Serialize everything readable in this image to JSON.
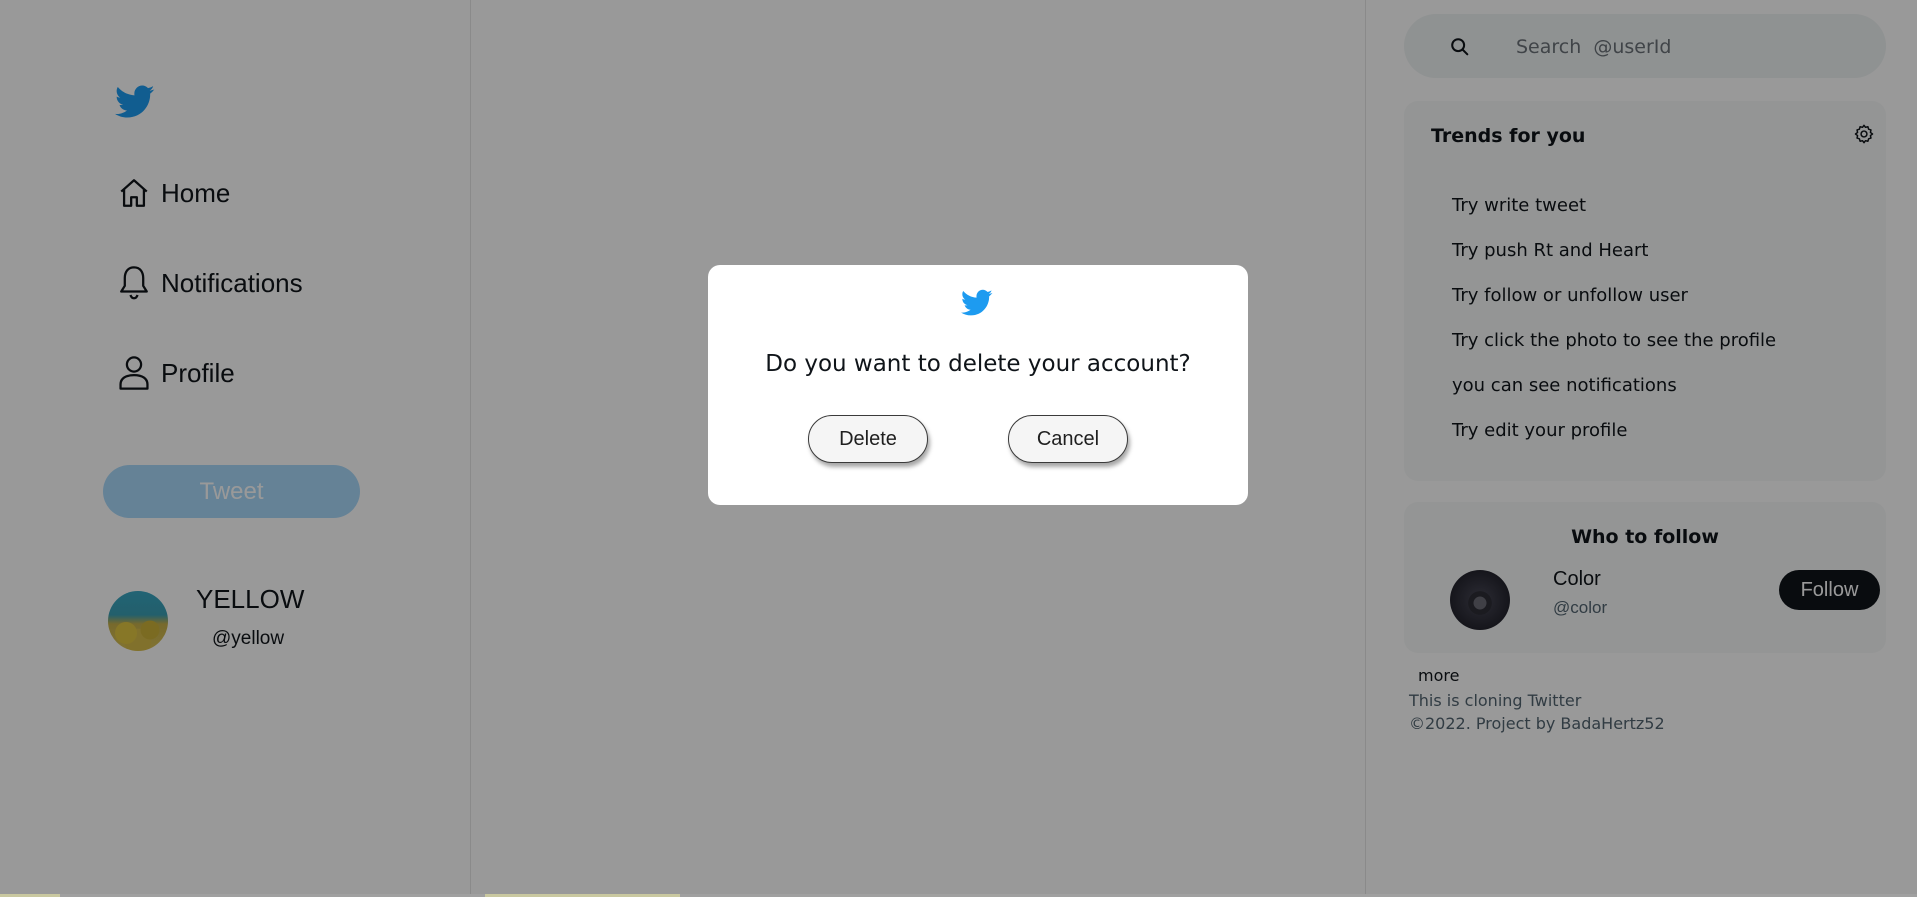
{
  "colors": {
    "brand": "#1d9bf0",
    "tweet_button_disabled": "#a9d9fb",
    "overlay": "rgba(0,0,0,0.40)",
    "follow_button": "#0f1419"
  },
  "sidebar": {
    "logo_icon": "twitter-bird-icon",
    "nav": [
      {
        "label": "Home",
        "icon": "home-icon"
      },
      {
        "label": "Notifications",
        "icon": "bell-icon"
      },
      {
        "label": "Profile",
        "icon": "user-icon"
      }
    ],
    "tweet_label": "Tweet",
    "user": {
      "name": "YELLOW",
      "handle": "@yellow"
    }
  },
  "search": {
    "placeholder": "Search  @userId",
    "icon": "search-icon"
  },
  "trends": {
    "title": "Trends for you",
    "settings_icon": "gear-icon",
    "items": [
      "Try write tweet",
      "Try push Rt and Heart",
      "Try follow or unfollow user",
      "Try click the photo to see the profile",
      "you can see notifications",
      "Try edit your profile"
    ]
  },
  "who_to_follow": {
    "title": "Who to follow",
    "user": {
      "name": "Color",
      "handle": "@color"
    },
    "follow_label": "Follow"
  },
  "footer": {
    "more_label": "more",
    "line1": "This is cloning Twitter",
    "line2": "©2022.  Project  by  BadaHertz52"
  },
  "modal": {
    "logo_icon": "twitter-bird-icon",
    "question": "Do you want to delete your account?",
    "delete_label": "Delete",
    "cancel_label": "Cancel"
  }
}
